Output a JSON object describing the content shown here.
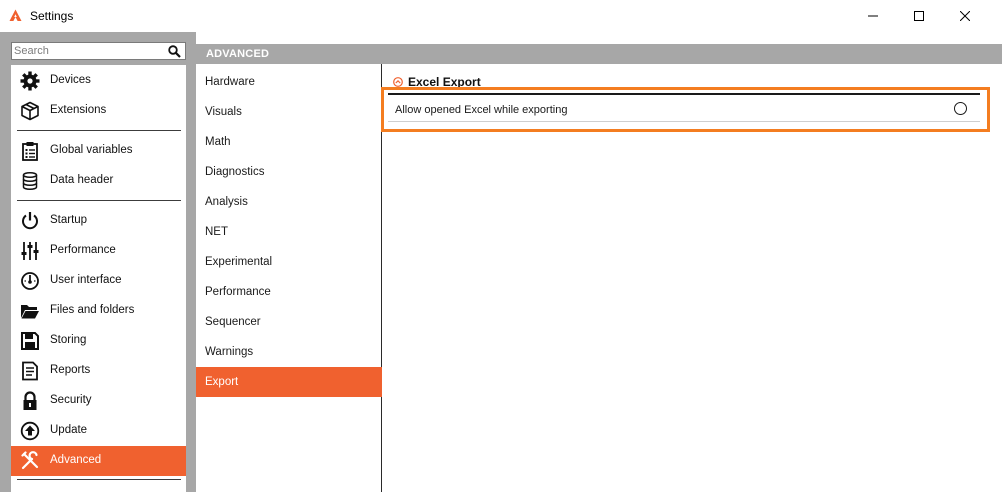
{
  "window": {
    "title": "Settings",
    "accent_color": "#f0612f",
    "highlight_color": "#f47d20"
  },
  "search": {
    "placeholder": "Search"
  },
  "sidebar": {
    "items": [
      {
        "label": "Devices",
        "icon": "gear-icon"
      },
      {
        "label": "Extensions",
        "icon": "cube-icon"
      },
      {
        "label": "Global variables",
        "icon": "clipboard-list-icon"
      },
      {
        "label": "Data header",
        "icon": "database-icon"
      },
      {
        "label": "Startup",
        "icon": "power-icon"
      },
      {
        "label": "Performance",
        "icon": "sliders-icon"
      },
      {
        "label": "User interface",
        "icon": "gauge-icon"
      },
      {
        "label": "Files and folders",
        "icon": "folder-open-icon"
      },
      {
        "label": "Storing",
        "icon": "floppy-disk-icon"
      },
      {
        "label": "Reports",
        "icon": "report-icon"
      },
      {
        "label": "Security",
        "icon": "lock-icon"
      },
      {
        "label": "Update",
        "icon": "upload-circle-icon"
      },
      {
        "label": "Advanced",
        "icon": "tools-icon",
        "active": true
      }
    ]
  },
  "main": {
    "header": "ADVANCED",
    "categories": [
      {
        "label": "Hardware"
      },
      {
        "label": "Visuals"
      },
      {
        "label": "Math"
      },
      {
        "label": "Diagnostics"
      },
      {
        "label": "Analysis"
      },
      {
        "label": "NET"
      },
      {
        "label": "Experimental"
      },
      {
        "label": "Performance"
      },
      {
        "label": "Sequencer"
      },
      {
        "label": "Warnings"
      },
      {
        "label": "Export",
        "active": true
      }
    ],
    "section": {
      "title": "Excel Export",
      "icon": "collapse-up-icon",
      "settings": [
        {
          "label": "Allow opened Excel while exporting",
          "control": "radio",
          "checked": false
        }
      ]
    }
  }
}
